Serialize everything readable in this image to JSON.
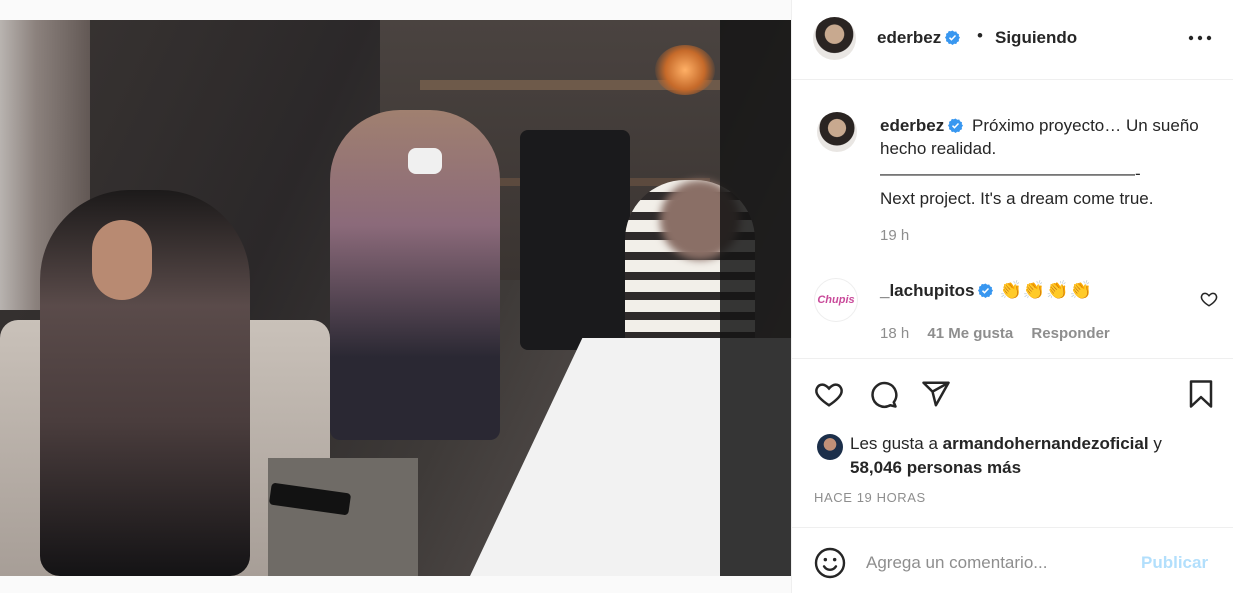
{
  "post": {
    "username": "ederbez",
    "follow_status": "Siguiendo",
    "separator": "•",
    "caption_lines": [
      "Próximo proyecto… Un sueño hecho realidad.",
      "———————————————-",
      "Next project. It's a dream come true."
    ],
    "caption_time": "19 h"
  },
  "comment": {
    "avatar_text": "Chupis",
    "username": "_lachupitos",
    "text": "👏👏👏👏",
    "time": "18 h",
    "likes": "41 Me gusta",
    "reply": "Responder"
  },
  "likes": {
    "prefix": "Les gusta a",
    "user": "armandohernandezoficial",
    "connector": "y",
    "others": "58,046 personas más"
  },
  "timestamp": "HACE 19 HORAS",
  "comment_box": {
    "placeholder": "Agrega un comentario...",
    "publish_label": "Publicar"
  },
  "colors": {
    "verified": "#3897f0",
    "publish_disabled": "#b2dffc",
    "secondary_text": "#8e8e8e"
  },
  "icons": [
    "more-icon",
    "verified-icon",
    "heart-icon",
    "comment-icon",
    "share-icon",
    "bookmark-icon",
    "emoji-icon"
  ]
}
